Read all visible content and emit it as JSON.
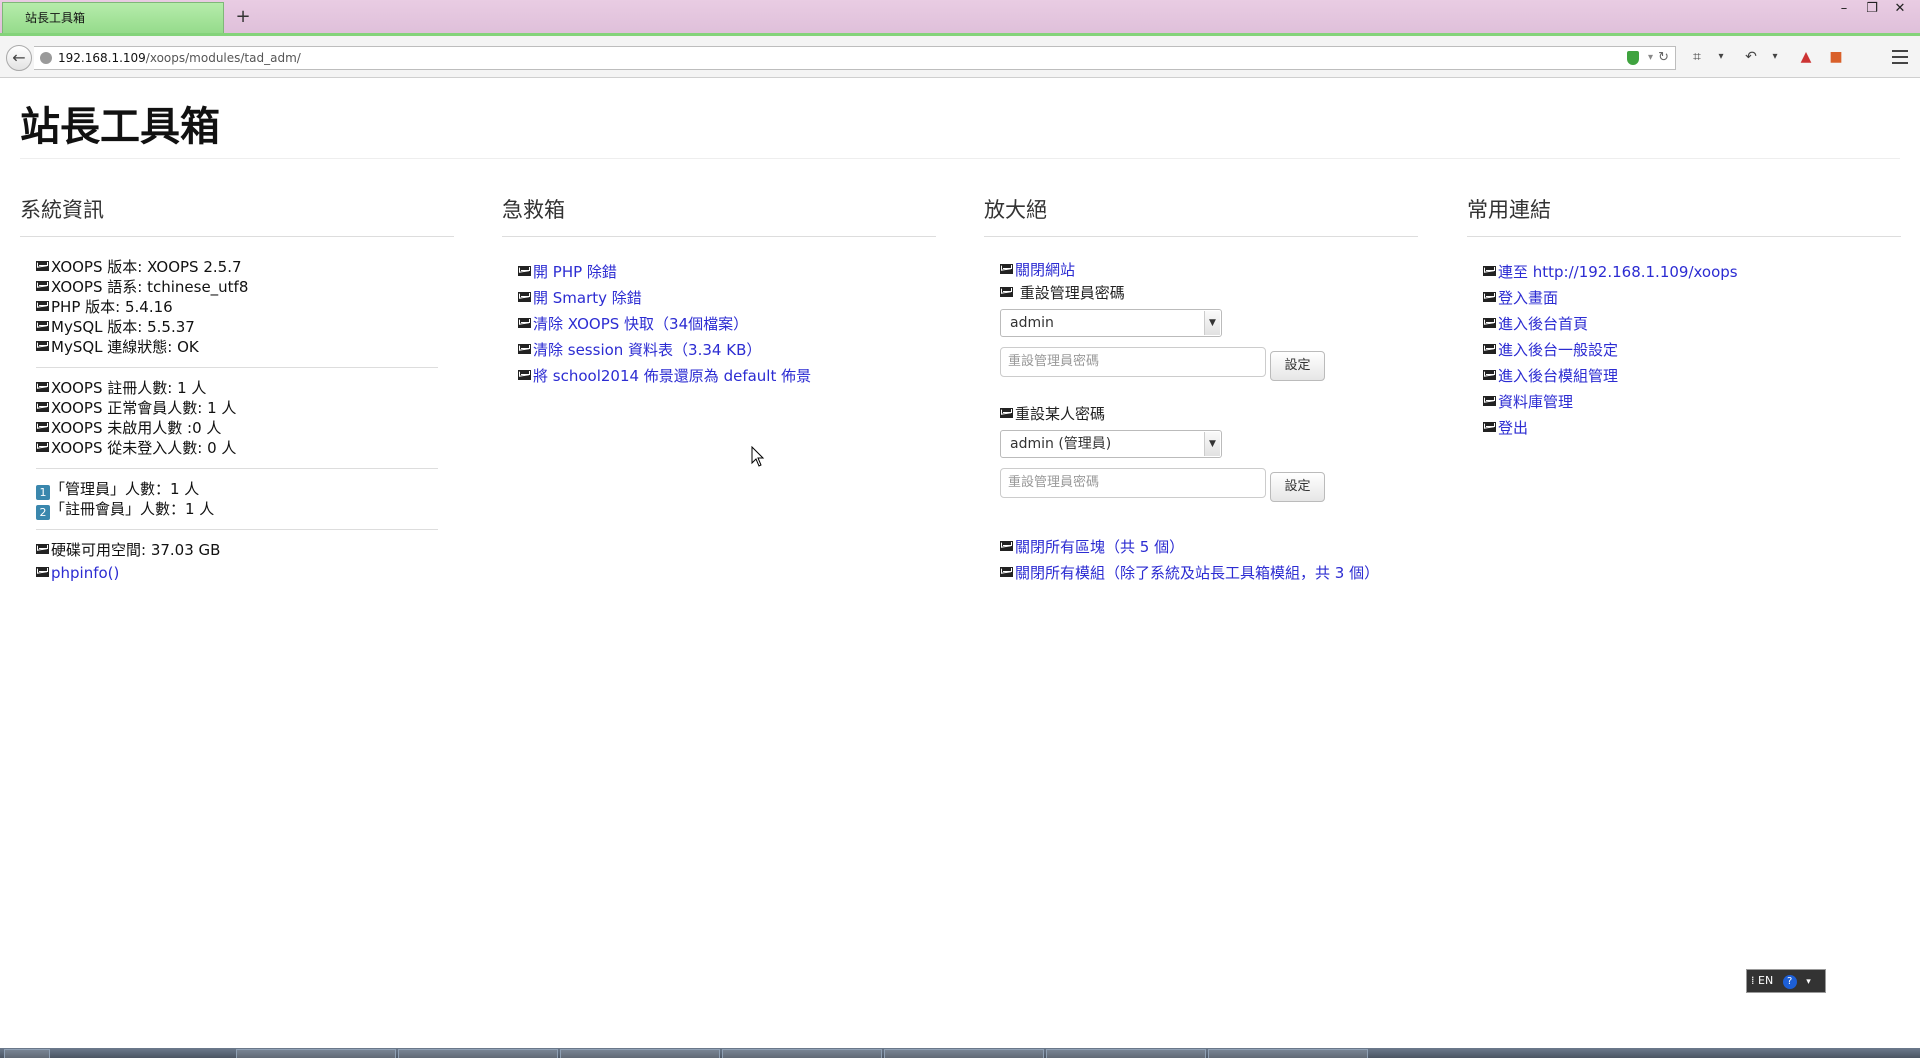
{
  "browser": {
    "tab_title": "站長工具箱",
    "new_tab": "+",
    "win_minimize": "–",
    "win_restore": "❐",
    "win_close": "✕",
    "url_host": "192.168.1.109",
    "url_path": "/xoops/modules/tad_adm/"
  },
  "page": {
    "title": "站長工具箱"
  },
  "sysinfo": {
    "heading": "系統資訊",
    "lines": [
      "XOOPS 版本: XOOPS 2.5.7",
      "XOOPS 語系: tchinese_utf8",
      "PHP 版本: 5.4.16",
      "MySQL 版本: 5.5.37",
      "MySQL 連線狀態: OK"
    ],
    "members": [
      "XOOPS 註冊人數: 1 人",
      "XOOPS 正常會員人數: 1 人",
      "XOOPS 未啟用人數 :0 人",
      "XOOPS 從未登入人數: 0 人"
    ],
    "groups": [
      {
        "badge": "1",
        "text": "「管理員」人數：1 人"
      },
      {
        "badge": "2",
        "text": "「註冊會員」人數：1 人"
      }
    ],
    "disk": "硬碟可用空間: 37.03 GB",
    "phpinfo": "phpinfo()"
  },
  "rescue": {
    "heading": "急救箱",
    "links": [
      "開 PHP 除錯",
      "開 Smarty 除錯",
      "清除 XOOPS 快取（34個檔案）",
      "清除 session 資料表（3.34 KB）",
      "將 school2014 佈景還原為 default 佈景"
    ]
  },
  "zoom": {
    "heading": "放大絕",
    "close_site": "關閉網站",
    "reset_admin_label": "重設管理員密碼",
    "admin_select": "admin",
    "admin_pw_placeholder": "重設管理員密碼",
    "set_button": "設定",
    "reset_user_label": "重設某人密碼",
    "user_select": "admin (管理員)",
    "user_pw_placeholder": "重設管理員密碼",
    "set_button2": "設定",
    "close_blocks": "關閉所有區塊（共 5 個）",
    "close_modules": "關閉所有模組（除了系統及站長工具箱模組，共 3 個）"
  },
  "links": {
    "heading": "常用連結",
    "items": [
      "連至 http://192.168.1.109/xoops",
      "登入畫面",
      "進入後台首頁",
      "進入後台一般設定",
      "進入後台模組管理",
      "資料庫管理",
      "登出"
    ]
  },
  "ime": {
    "lang": "EN",
    "help": "?"
  },
  "colors": {
    "link": "#2c2cd2",
    "tab_active": "#a3e398",
    "tabbar_bg": "#e6c8e0",
    "badge": "#3a87ad"
  }
}
